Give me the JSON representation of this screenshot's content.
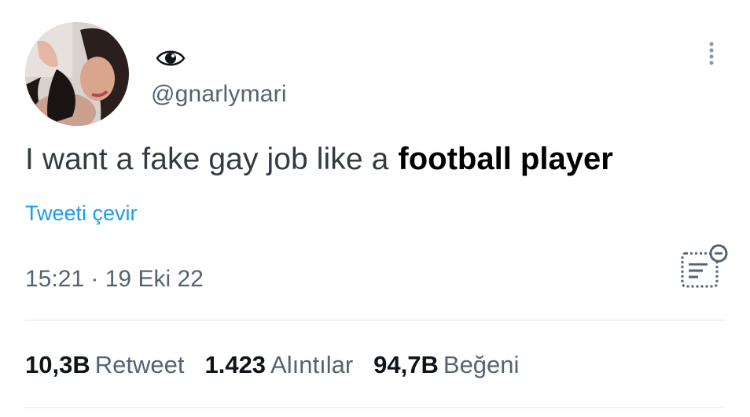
{
  "tweet": {
    "handle": "@gnarlymari",
    "text_plain": "I want a fake gay job like a",
    "text_bold": "football player",
    "translate_link": "Tweeti çevir",
    "timestamp": "15:21 · 19 Eki 22"
  },
  "stats": {
    "retweets": {
      "value": "10,3B",
      "label": "Retweet"
    },
    "quotes": {
      "value": "1.423",
      "label": "Alıntılar"
    },
    "likes": {
      "value": "94,7B",
      "label": "Beğeni"
    }
  },
  "icons": {
    "display_name": "eye-icon",
    "more": "more-vertical-icon",
    "analytics": "analytics-icon"
  },
  "colors": {
    "link": "#1d9bf0",
    "secondary_text": "#536471",
    "primary_text": "#0f1419",
    "divider": "#eff3f4"
  }
}
